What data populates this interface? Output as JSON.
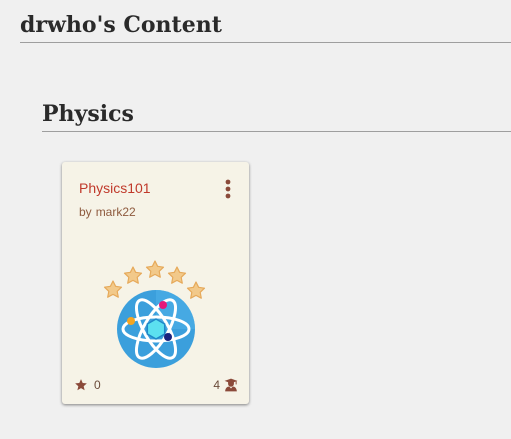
{
  "page": {
    "title": "drwho's Content"
  },
  "section": {
    "title": "Physics"
  },
  "cards": [
    {
      "title": "Physics101",
      "author_prefix": "by",
      "author": "mark22",
      "image_icon": "atom-with-stars-icon",
      "menu_icon": "more-vertical-icon",
      "stars_icon": "star-icon",
      "stars_count": "0",
      "students_icon": "student-icon",
      "students_count": "4"
    }
  ],
  "colors": {
    "background": "#f0f0f0",
    "card_background": "#f6f3e7",
    "card_title": "#c0392b",
    "author_text": "#8e5a3e",
    "icon_brown": "#8b4a3a",
    "heading_text": "#2a2a2a",
    "heading_rule": "#9e9e9e"
  }
}
